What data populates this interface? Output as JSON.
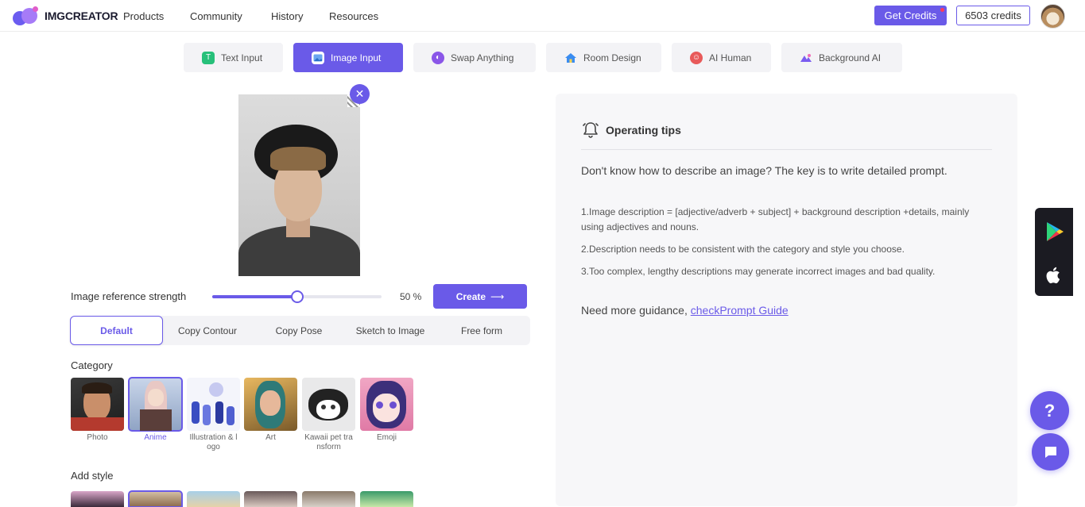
{
  "header": {
    "brand": "IMGCREATOR",
    "nav": [
      "Products",
      "Community",
      "History",
      "Resources"
    ],
    "get_credits": "Get Credits",
    "credits": "6503 credits"
  },
  "tabs": [
    {
      "label": "Text Input",
      "icon": "text-icon",
      "color": "#27c07a"
    },
    {
      "label": "Image Input",
      "icon": "image-icon",
      "color": "#ffffff"
    },
    {
      "label": "Swap Anything",
      "icon": "swap-icon",
      "color": "#8a56e8"
    },
    {
      "label": "Room Design",
      "icon": "house-icon",
      "color": "#3a8cf0"
    },
    {
      "label": "AI Human",
      "icon": "human-icon",
      "color": "#e85a5a"
    },
    {
      "label": "Background AI",
      "icon": "background-icon",
      "color": "#7a5cf0"
    }
  ],
  "strength": {
    "label": "Image reference strength",
    "value_text": "50 %",
    "value": 0.5
  },
  "create_label": "Create",
  "modes": [
    "Default",
    "Copy Contour",
    "Copy Pose",
    "Sketch to Image",
    "Free form"
  ],
  "category_label": "Category",
  "categories": [
    "Photo",
    "Anime",
    "Illustration & l ogo",
    "Art",
    "Kawaii pet tra nsform",
    "Emoji"
  ],
  "add_style_label": "Add style",
  "tips": {
    "title": "Operating tips",
    "lead": "Don't know how to describe an image? The key is to write detailed prompt.",
    "items": [
      "1.Image description = [adjective/adverb + subject] + background description +details, mainly using adjectives and nouns.",
      "2.Description needs to be consistent with the category and style you choose.",
      "3.Too complex, lengthy descriptions may generate incorrect images and bad quality."
    ],
    "more_prefix": "Need more guidance, ",
    "more_link": "checkPrompt Guide"
  },
  "help_label": "?",
  "accent": "#6a5ae8"
}
